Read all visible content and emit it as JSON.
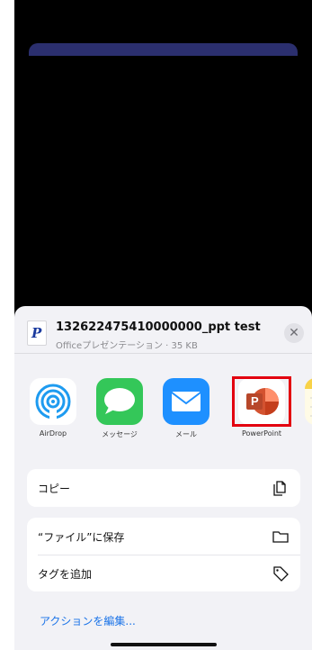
{
  "share_sheet": {
    "file_icon_letter": "P",
    "file_name": "132622475410000000_ppt test",
    "file_subtitle": "Officeプレゼンテーション · 35 KB",
    "close_symbol": "✕"
  },
  "apps": [
    {
      "label": "AirDrop",
      "icon": "airdrop-icon"
    },
    {
      "label": "メッセージ",
      "icon": "messages-icon"
    },
    {
      "label": "メール",
      "icon": "mail-icon"
    },
    {
      "label": "PowerPoint",
      "icon": "powerpoint-icon"
    },
    {
      "label": "",
      "icon": "notes-icon"
    }
  ],
  "powerpoint_badge_letter": "P",
  "actions": {
    "copy": "コピー",
    "save_to_files": "“ファイル”に保存",
    "add_tag": "タグを追加",
    "edit_actions": "アクションを編集..."
  },
  "colors": {
    "highlight": "#e3000f",
    "link": "#1a73e8",
    "messages_green": "#34c759",
    "mail_blue": "#1e90ff"
  }
}
